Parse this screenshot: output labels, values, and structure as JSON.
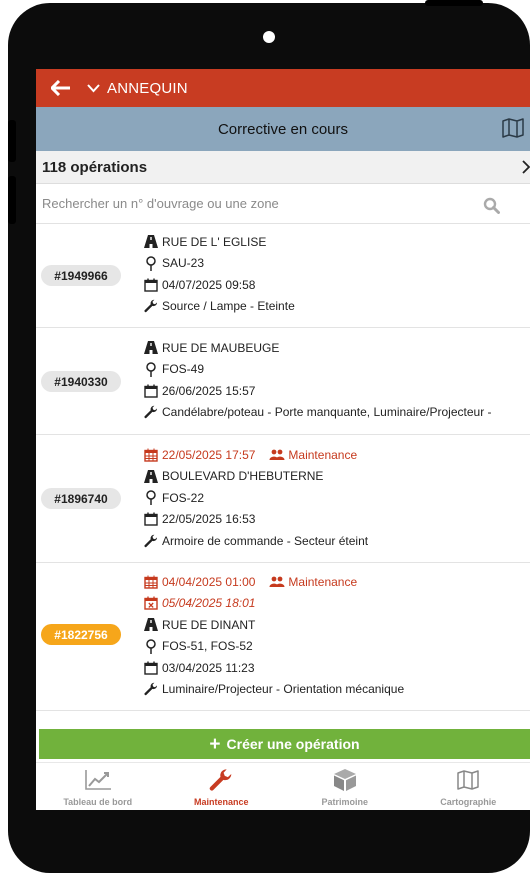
{
  "header": {
    "title": "ANNEQUIN"
  },
  "subheader": {
    "title": "Corrective en cours"
  },
  "count": {
    "label": "118 opérations"
  },
  "search": {
    "placeholder": "Rechercher un n° d'ouvrage ou une zone",
    "value": ""
  },
  "colors": {
    "appbar": "#c83c22",
    "subbar": "#8ba6bc",
    "create": "#71b23c",
    "badge_warn": "#f6a61a",
    "alert_text": "#c63a1e"
  },
  "operations": [
    {
      "id": "#1949966",
      "street": "RUE DE L' EGLISE",
      "points": "SAU-23",
      "created": "04/07/2025 09:58",
      "fault": "Source / Lampe - Eteinte"
    },
    {
      "id": "#1940330",
      "street": "RUE DE MAUBEUGE",
      "points": "FOS-49",
      "created": "26/06/2025 15:57",
      "fault": "Candélabre/poteau - Porte manquante, Luminaire/Projecteur -"
    },
    {
      "id": "#1896740",
      "planned": "22/05/2025 17:57",
      "team": "Maintenance",
      "street": "BOULEVARD D'HEBUTERNE",
      "points": "FOS-22",
      "created": "22/05/2025 16:53",
      "fault": "Armoire de commande - Secteur éteint"
    },
    {
      "id": "#1822756",
      "planned": "04/04/2025 01:00",
      "team": "Maintenance",
      "deadline": "05/04/2025 18:01",
      "street": "RUE DE DINANT",
      "points": "FOS-51, FOS-52",
      "created": "03/04/2025 11:23",
      "fault": "Luminaire/Projecteur - Orientation mécanique"
    }
  ],
  "create_button": {
    "label": "Créer une opération"
  },
  "tabs": [
    {
      "label": "Tableau de bord",
      "icon": "chart-line-icon",
      "active": false
    },
    {
      "label": "Maintenance",
      "icon": "wrench-icon",
      "active": true
    },
    {
      "label": "Patrimoine",
      "icon": "cube-icon",
      "active": false
    },
    {
      "label": "Cartographie",
      "icon": "map-icon",
      "active": false
    }
  ]
}
